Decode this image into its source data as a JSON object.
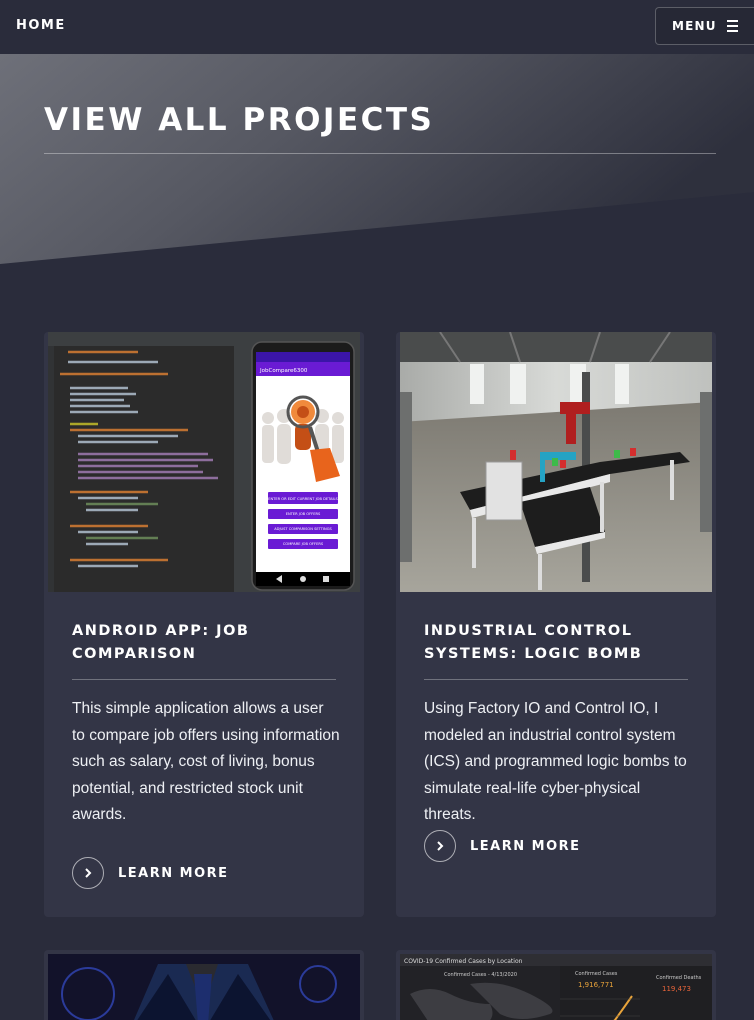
{
  "nav": {
    "home_label": "HOME",
    "menu_label": "MENU"
  },
  "hero": {
    "title": "VIEW ALL PROJECTS"
  },
  "projects": [
    {
      "title": "ANDROID APP: JOB COMPARISON",
      "description": "This simple application allows a user to compare job offers using information such as salary, cost of living, bonus potential, and restricted stock unit awards.",
      "link_label": "LEARN MORE",
      "image": {
        "app_bar": "JobCompare6300",
        "buttons": [
          "ENTER OR EDIT CURRENT JOB DETAILS",
          "ENTER JOB OFFERS",
          "ADJUST COMPARISON SETTINGS",
          "COMPARE JOB OFFERS"
        ]
      }
    },
    {
      "title": "INDUSTRIAL CONTROL SYSTEMS: LOGIC BOMB",
      "description": "Using Factory IO and Control IO, I modeled an industrial control system (ICS) and programmed logic bombs to simulate real-life cyber-physical threats.",
      "link_label": "LEARN MORE"
    },
    {
      "title": "",
      "image_name": "business-person"
    },
    {
      "image": {
        "header": "COVID-19 Confirmed Cases by Location",
        "col1": "Confirmed Cases - 4/13/2020",
        "col2": "Confirmed Cases",
        "col2_value": "1,916,771",
        "col3": "Confirmed Deaths",
        "col3_value": "119,473"
      }
    }
  ],
  "colors": {
    "background": "#2a2c3b",
    "card": "#333546",
    "accent_orange": "#e8641c",
    "accent_purple": "#6a1bd4"
  }
}
